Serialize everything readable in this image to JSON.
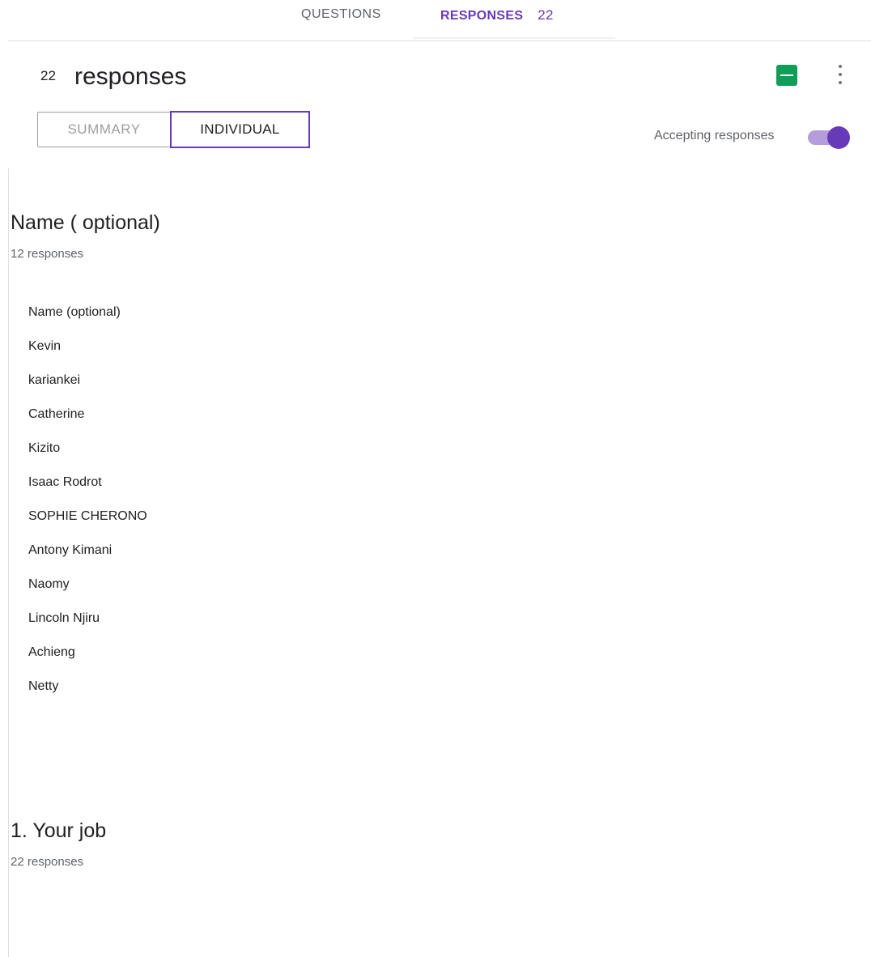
{
  "nav": {
    "questions_label": "QUESTIONS",
    "responses_label": "RESPONSES",
    "responses_count": "22"
  },
  "header": {
    "count": "22",
    "title": "responses",
    "summary_tab": "SUMMARY",
    "individual_tab": "INDIVIDUAL",
    "accepting_label": "Accepting responses",
    "accepting_on": true,
    "accent_color": "#673ab7",
    "sheets_color": "#0f9d58"
  },
  "questions": [
    {
      "title": "Name ( optional)",
      "subtitle": "12 responses",
      "answers": [
        "Name (optional)",
        "Kevin",
        "kariankei",
        "Catherine",
        "Kizito",
        "Isaac Rodrot",
        "SOPHIE CHERONO",
        "Antony Kimani",
        "Naomy",
        "Lincoln Njiru",
        "Achieng",
        "Netty"
      ]
    },
    {
      "title": "1. Your job",
      "subtitle": "22 responses"
    }
  ]
}
